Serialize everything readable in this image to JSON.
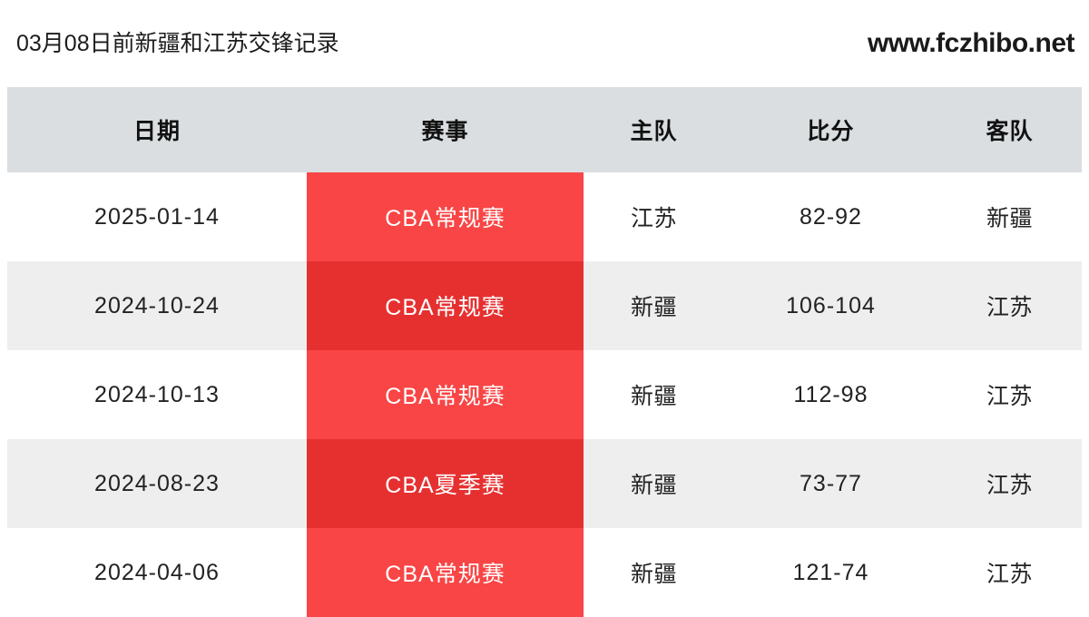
{
  "header": {
    "title": "03月08日前新疆和江苏交锋记录",
    "watermark": "www.fczhibo.net"
  },
  "table": {
    "columns": [
      {
        "key": "date",
        "label": "日期"
      },
      {
        "key": "comp",
        "label": "赛事"
      },
      {
        "key": "home",
        "label": "主队"
      },
      {
        "key": "score",
        "label": "比分"
      },
      {
        "key": "away",
        "label": "客队"
      }
    ],
    "rows": [
      {
        "date": "2025-01-14",
        "comp": "CBA常规赛",
        "home": "江苏",
        "score": "82-92",
        "away": "新疆"
      },
      {
        "date": "2024-10-24",
        "comp": "CBA常规赛",
        "home": "新疆",
        "score": "106-104",
        "away": "江苏"
      },
      {
        "date": "2024-10-13",
        "comp": "CBA常规赛",
        "home": "新疆",
        "score": "112-98",
        "away": "江苏"
      },
      {
        "date": "2024-08-23",
        "comp": "CBA夏季赛",
        "home": "新疆",
        "score": "73-77",
        "away": "江苏"
      },
      {
        "date": "2024-04-06",
        "comp": "CBA常规赛",
        "home": "新疆",
        "score": "121-74",
        "away": "江苏"
      }
    ]
  },
  "colors": {
    "competition_red_light": "#f94545",
    "competition_red_dark": "#e63030",
    "header_background": "#dadee0",
    "row_alt_background": "#efeeee",
    "text": "#222222"
  }
}
